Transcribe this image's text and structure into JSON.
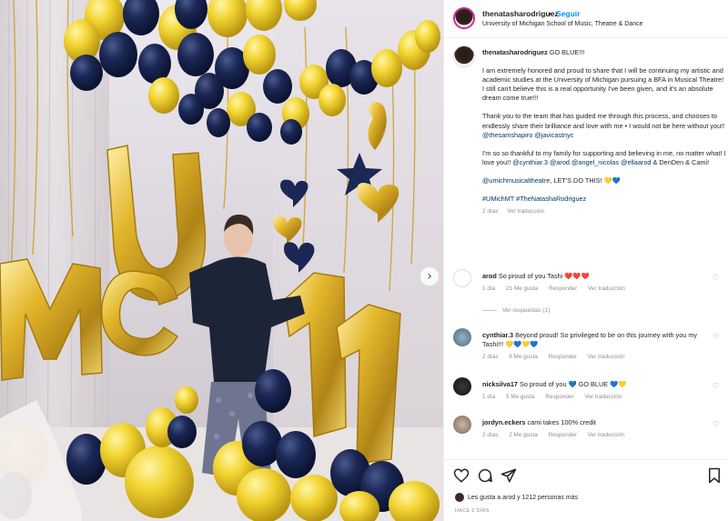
{
  "post_header": {
    "username": "thenatasharodriguez",
    "separator": "•",
    "follow_label": "Seguir",
    "subtitle": "University of Michigan School of Music, Theatre & Dance"
  },
  "caption": {
    "username": "thenatasharodriguez",
    "first_line": "GO BLUE!!!",
    "p1": "I am extremely honored and proud to share that I will be continuing my artistic and academic studies at the University of Michigan pursuing a BFA in Musical Theatre! I still can't believe this is a real opportunity I've been given, and it's an absolute dream come true!!!",
    "p2_text": "Thank you to the team that has guided me through this process, and chooses to endlessly share their brilliance and love with me • I would not be here without you!!",
    "p2_mention1": "@thesamshapiro",
    "p2_mention2": "@javicastnyc",
    "p3_text": "I'm so so thankful to my family for supporting and believing in me, no matter what! I love you!!",
    "p3_mention1": "@cynthiar.3",
    "p3_mention2": "@arod",
    "p3_mention3": "@angel_nicolas",
    "p3_mention4": "@ellaarod",
    "p3_tail": "& DenDen & Cami!",
    "p4_mention": "@umichmusicaltheatre",
    "p4_text": ", LET'S DO THIS! 💛💙",
    "hashtags": "#UMichMT #TheNatashaRodriguez",
    "time": "2 días",
    "translate": "Ver traducción"
  },
  "comments": [
    {
      "username": "arod",
      "text": "So proud of you Tashi ❤️❤️❤️",
      "time": "1 día",
      "likes": "21 Me gusta",
      "reply": "Responder",
      "translate": "Ver traducción"
    },
    {
      "username": "cynthiar.3",
      "text": "Beyond proud! So privileged to be on this journey with you my Tashi!!! 💛💙💛💙",
      "time": "2 días",
      "likes": "8 Me gusta",
      "reply": "Responder",
      "translate": "Ver traducción"
    },
    {
      "username": "nicksilva17",
      "text": "So proud of you 💙 GO BLUE 💙💛",
      "time": "1 día",
      "likes": "5 Me gusta",
      "reply": "Responder",
      "translate": "Ver traducción"
    },
    {
      "username": "jordyn.eckers",
      "text": "cami takes 100% credit",
      "time": "2 días",
      "likes": "2 Me gusta",
      "reply": "Responder",
      "translate": "Ver traducción"
    }
  ],
  "view_replies": "Ver respuestas (1)",
  "likes_summary": "Les gusta a arod y 1212 personas más",
  "posted_ago": "HACE 2 DÍAS",
  "icons": {
    "like": "heart-icon",
    "comment": "comment-icon",
    "share": "send-icon",
    "save": "bookmark-icon",
    "next": "chevron-right-icon"
  },
  "colors": {
    "link": "#00376b",
    "follow": "#0095f6",
    "balloon_gold": "#e5b92a",
    "balloon_yellow": "#f2d431",
    "balloon_navy": "#15214a"
  }
}
